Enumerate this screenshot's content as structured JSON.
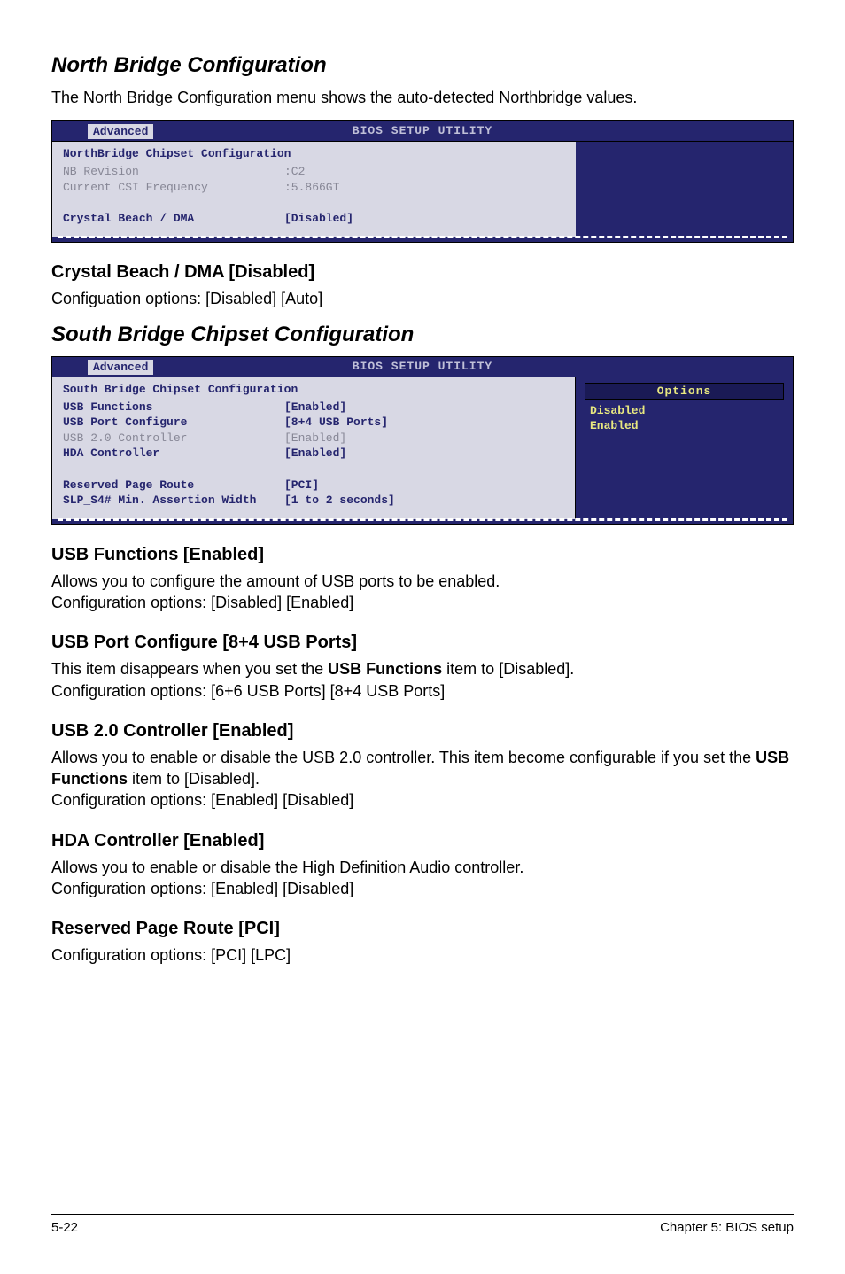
{
  "section1_title": "North Bridge Configuration",
  "section1_intro": "The North Bridge Configuration menu shows the auto-detected Northbridge values.",
  "bios1": {
    "utility_title": "BIOS SETUP UTILITY",
    "tab": "Advanced",
    "heading": "NorthBridge Chipset Configuration",
    "rows": [
      {
        "k": "NB Revision",
        "v": ":C2",
        "cls": "grey"
      },
      {
        "k": "Current CSI Frequency",
        "v": ":5.866GT",
        "cls": "grey"
      },
      {
        "k": " ",
        "v": " ",
        "cls": "grey"
      },
      {
        "k": "Crystal Beach / DMA",
        "v": "[Disabled]",
        "cls": "blue"
      }
    ]
  },
  "crystal_heading": "Crystal Beach / DMA [Disabled]",
  "crystal_body": "Configuation options: [Disabled] [Auto]",
  "section2_title": "South Bridge Chipset Configuration",
  "bios2": {
    "utility_title": "BIOS SETUP UTILITY",
    "tab": "Advanced",
    "heading": "South Bridge Chipset Configuration",
    "rows": [
      {
        "k": "USB Functions",
        "v": "[Enabled]",
        "cls": "blue"
      },
      {
        "k": "USB Port Configure",
        "v": "[8+4 USB Ports]",
        "cls": "blue"
      },
      {
        "k": "USB 2.0 Controller",
        "v": "[Enabled]",
        "cls": "grey"
      },
      {
        "k": "HDA Controller",
        "v": "[Enabled]",
        "cls": "blue"
      },
      {
        "k": " ",
        "v": " ",
        "cls": "blue"
      },
      {
        "k": "Reserved Page Route",
        "v": "[PCI]",
        "cls": "blue"
      },
      {
        "k": "SLP_S4# Min. Assertion Width",
        "v": "[1 to 2 seconds]",
        "cls": "blue"
      }
    ],
    "options_label": "Options",
    "options": [
      "Disabled",
      "Enabled"
    ]
  },
  "sub": [
    {
      "h": "USB Functions [Enabled]",
      "p": "Allows you to configure the amount of USB ports to be enabled.\nConfiguration options: [Disabled] [Enabled]"
    },
    {
      "h": "USB Port Configure [8+4 USB Ports]",
      "p": "This item disappears when you set the USB Functions item to [Disabled].\nConfiguration options: [6+6 USB Ports] [8+4 USB Ports]",
      "bold": "USB Functions"
    },
    {
      "h": "USB 2.0 Controller [Enabled]",
      "p": "Allows you to enable or disable the USB 2.0 controller. This item become configurable if you set the USB Functions item to [Disabled].\nConfiguration options: [Enabled] [Disabled]",
      "bold": "USB Functions"
    },
    {
      "h": "HDA Controller [Enabled]",
      "p": "Allows you to enable or disable the High Definition Audio controller.\nConfiguration options: [Enabled] [Disabled]"
    },
    {
      "h": "Reserved Page Route [PCI]",
      "p": "Configuration options: [PCI] [LPC]"
    }
  ],
  "footer_left": "5-22",
  "footer_right": "Chapter 5: BIOS setup"
}
